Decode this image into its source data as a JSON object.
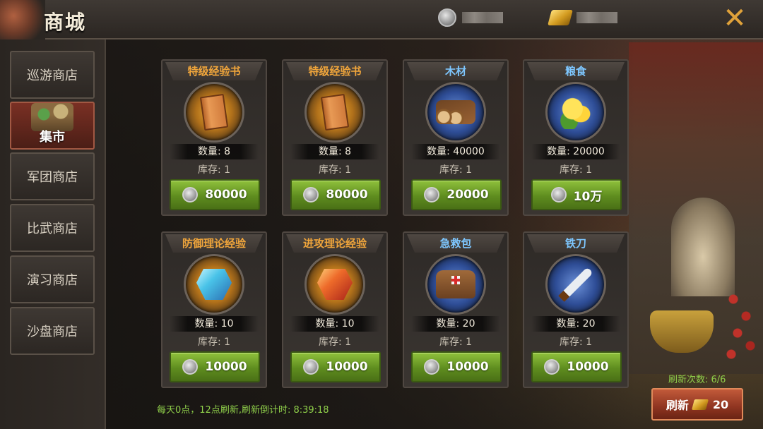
{
  "header": {
    "title": "商城",
    "close_icon": "✕",
    "currencies": [
      {
        "icon": "silver-coin-icon",
        "amount": ""
      },
      {
        "icon": "gold-bar-icon",
        "amount": ""
      }
    ]
  },
  "sidebar": {
    "items": [
      {
        "label": "巡游商店",
        "active": false
      },
      {
        "label": "集市",
        "active": true,
        "icon": "market-stall-icon"
      },
      {
        "label": "军团商店",
        "active": false
      },
      {
        "label": "比武商店",
        "active": false
      },
      {
        "label": "演习商店",
        "active": false
      },
      {
        "label": "沙盘商店",
        "active": false
      }
    ]
  },
  "items": [
    {
      "name": "特级经验书",
      "name_color": "orange",
      "art": "book-icon",
      "ring": "orange",
      "qty": "数量: 8",
      "stock": "库存: 1",
      "price": "80000"
    },
    {
      "name": "特级经验书",
      "name_color": "orange",
      "art": "book-icon",
      "ring": "orange",
      "qty": "数量: 8",
      "stock": "库存: 1",
      "price": "80000"
    },
    {
      "name": "木材",
      "name_color": "blue",
      "art": "wood-logs-icon",
      "ring": "blue",
      "qty": "数量: 40000",
      "stock": "库存: 1",
      "price": "20000"
    },
    {
      "name": "粮食",
      "name_color": "blue",
      "art": "corn-icon",
      "ring": "blue",
      "qty": "数量: 20000",
      "stock": "库存: 1",
      "price": "10万"
    },
    {
      "name": "防御理论经验",
      "name_color": "orange",
      "art": "blue-gem-icon",
      "ring": "orange",
      "qty": "数量: 10",
      "stock": "库存: 1",
      "price": "10000"
    },
    {
      "name": "进攻理论经验",
      "name_color": "orange",
      "art": "red-gem-icon",
      "ring": "orange",
      "qty": "数量: 10",
      "stock": "库存: 1",
      "price": "10000"
    },
    {
      "name": "急救包",
      "name_color": "blue",
      "art": "first-aid-bag-icon",
      "ring": "blue",
      "qty": "数量: 20",
      "stock": "库存: 1",
      "price": "10000"
    },
    {
      "name": "铁刀",
      "name_color": "blue",
      "art": "iron-knife-icon",
      "ring": "blue",
      "qty": "数量: 20",
      "stock": "库存: 1",
      "price": "10000"
    }
  ],
  "footer": {
    "refresh_timer": "每天0点，12点刷新,刷新倒计时: 8:39:18",
    "refresh_count": "刷新次数: 6/6",
    "refresh_label": "刷新",
    "refresh_cost": "20"
  },
  "colors": {
    "accent_orange": "#f0a53b",
    "accent_blue": "#7ec7ff",
    "buy_green": "#6f9f28",
    "refresh_red": "#8e3420",
    "footer_green": "#8fcf4a"
  }
}
